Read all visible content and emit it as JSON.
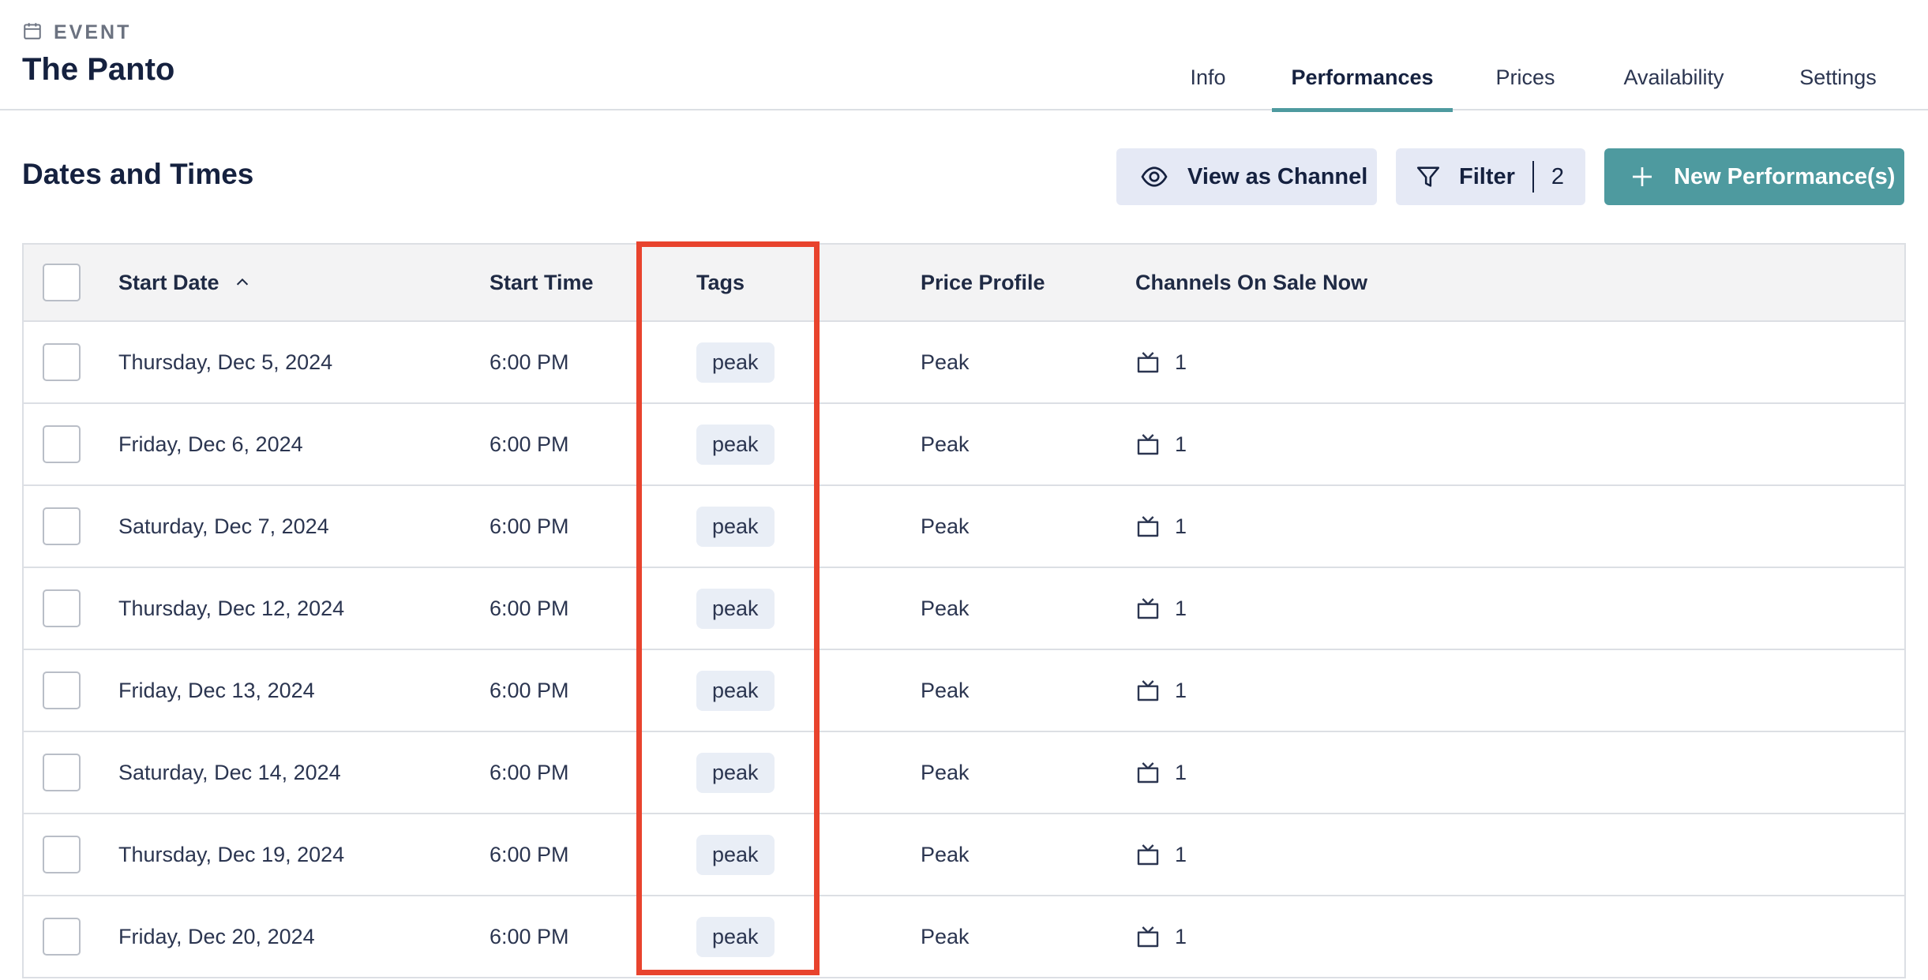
{
  "header": {
    "kicker_icon": "calendar-icon",
    "kicker": "EVENT",
    "title": "The Panto"
  },
  "tabs": [
    {
      "label": "Info",
      "active": false
    },
    {
      "label": "Performances",
      "active": true
    },
    {
      "label": "Prices",
      "active": false
    },
    {
      "label": "Availability",
      "active": false
    },
    {
      "label": "Settings",
      "active": false
    }
  ],
  "section": {
    "title": "Dates and Times"
  },
  "toolbar": {
    "view_as_channel": {
      "label": "View as Channel",
      "icon": "eye-icon"
    },
    "filter": {
      "label": "Filter",
      "count": "2",
      "icon": "filter-icon"
    },
    "new_performance": {
      "label": "New Performance(s)",
      "icon": "plus-icon"
    }
  },
  "table": {
    "columns": {
      "start_date": "Start Date",
      "start_time": "Start Time",
      "tags": "Tags",
      "price_profile": "Price Profile",
      "channels": "Channels On Sale Now"
    },
    "sort": {
      "column": "start_date",
      "direction": "ascending"
    },
    "rows": [
      {
        "date": "Thursday, Dec 5, 2024",
        "time": "6:00 PM",
        "tag": "peak",
        "price_profile": "Peak",
        "channels": "1"
      },
      {
        "date": "Friday, Dec 6, 2024",
        "time": "6:00 PM",
        "tag": "peak",
        "price_profile": "Peak",
        "channels": "1"
      },
      {
        "date": "Saturday, Dec 7, 2024",
        "time": "6:00 PM",
        "tag": "peak",
        "price_profile": "Peak",
        "channels": "1"
      },
      {
        "date": "Thursday, Dec 12, 2024",
        "time": "6:00 PM",
        "tag": "peak",
        "price_profile": "Peak",
        "channels": "1"
      },
      {
        "date": "Friday, Dec 13, 2024",
        "time": "6:00 PM",
        "tag": "peak",
        "price_profile": "Peak",
        "channels": "1"
      },
      {
        "date": "Saturday, Dec 14, 2024",
        "time": "6:00 PM",
        "tag": "peak",
        "price_profile": "Peak",
        "channels": "1"
      },
      {
        "date": "Thursday, Dec 19, 2024",
        "time": "6:00 PM",
        "tag": "peak",
        "price_profile": "Peak",
        "channels": "1"
      },
      {
        "date": "Friday, Dec 20, 2024",
        "time": "6:00 PM",
        "tag": "peak",
        "price_profile": "Peak",
        "channels": "1"
      }
    ]
  },
  "colors": {
    "accent": "#4e9a9f",
    "button_light": "#e5e9f5",
    "title": "#15213f",
    "highlight": "#e8432d",
    "tag_bg": "#e9eef6"
  }
}
